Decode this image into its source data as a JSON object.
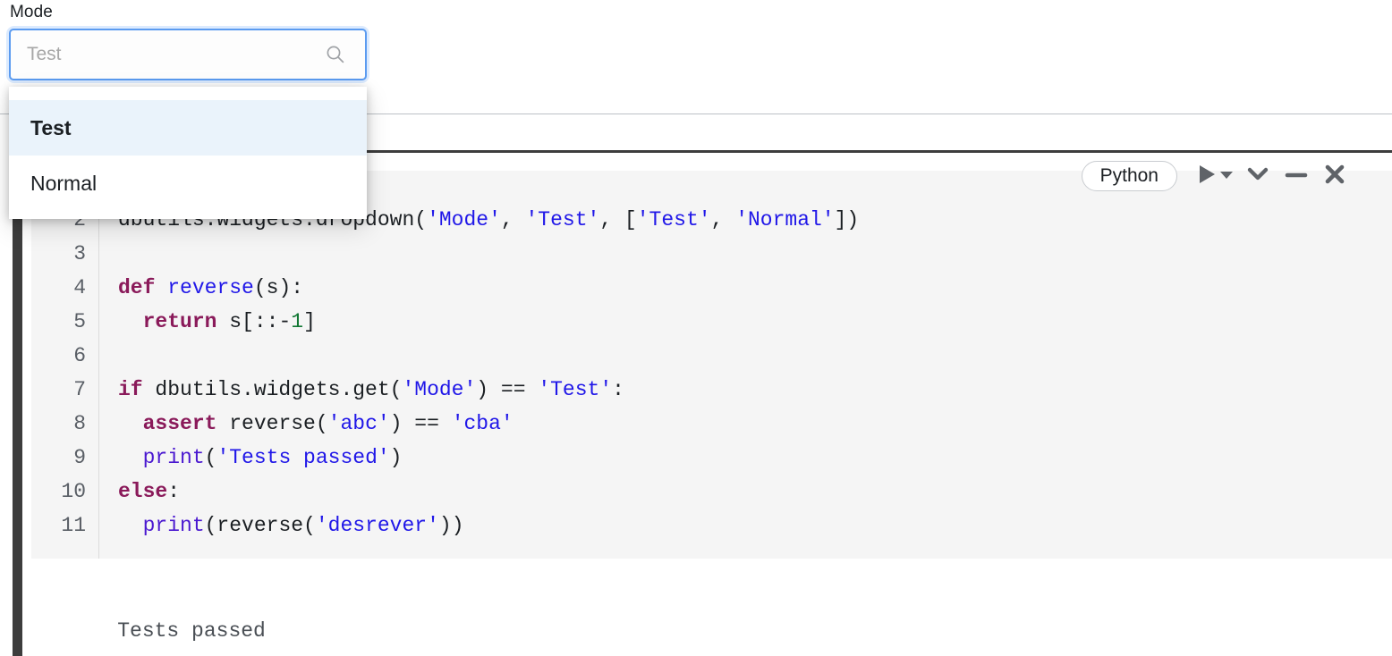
{
  "widget": {
    "label": "Mode",
    "input_value": "",
    "input_placeholder": "Test",
    "search_icon": "search-icon",
    "options": [
      {
        "label": "Test",
        "selected": true
      },
      {
        "label": "Normal",
        "selected": false
      }
    ],
    "focus_ring_color": "#5b9bf0",
    "selected_row_color": "#eaf3fb"
  },
  "cell": {
    "language_pill": "Python",
    "toolbar": {
      "run_icon": "play-icon",
      "run_menu_icon": "caret-down-icon",
      "collapse_icon": "chevron-down-icon",
      "minimize_icon": "minus-icon",
      "close_icon": "close-icon"
    },
    "accent_color": "#3d3d3d",
    "editor_background": "#f5f5f5",
    "line_numbers": [
      "2",
      "3",
      "4",
      "5",
      "6",
      "7",
      "8",
      "9",
      "10",
      "11"
    ],
    "code_lines": [
      {
        "n": "2",
        "tokens": [
          {
            "t": "plain",
            "v": "dbutils.widgets.dropdown("
          },
          {
            "t": "string",
            "v": "'Mode'"
          },
          {
            "t": "plain",
            "v": ", "
          },
          {
            "t": "string",
            "v": "'Test'"
          },
          {
            "t": "plain",
            "v": ", ["
          },
          {
            "t": "string",
            "v": "'Test'"
          },
          {
            "t": "plain",
            "v": ", "
          },
          {
            "t": "string",
            "v": "'Normal'"
          },
          {
            "t": "plain",
            "v": "])"
          }
        ]
      },
      {
        "n": "3",
        "tokens": []
      },
      {
        "n": "4",
        "tokens": [
          {
            "t": "keyword",
            "v": "def"
          },
          {
            "t": "plain",
            "v": " "
          },
          {
            "t": "function",
            "v": "reverse"
          },
          {
            "t": "plain",
            "v": "(s):"
          }
        ]
      },
      {
        "n": "5",
        "tokens": [
          {
            "t": "plain",
            "v": "  "
          },
          {
            "t": "keyword",
            "v": "return"
          },
          {
            "t": "plain",
            "v": " s[::-"
          },
          {
            "t": "number",
            "v": "1"
          },
          {
            "t": "plain",
            "v": "]"
          }
        ]
      },
      {
        "n": "6",
        "tokens": []
      },
      {
        "n": "7",
        "tokens": [
          {
            "t": "keyword",
            "v": "if"
          },
          {
            "t": "plain",
            "v": " dbutils.widgets.get("
          },
          {
            "t": "string",
            "v": "'Mode'"
          },
          {
            "t": "plain",
            "v": ") == "
          },
          {
            "t": "string",
            "v": "'Test'"
          },
          {
            "t": "plain",
            "v": ":"
          }
        ]
      },
      {
        "n": "8",
        "tokens": [
          {
            "t": "plain",
            "v": "  "
          },
          {
            "t": "keyword",
            "v": "assert"
          },
          {
            "t": "plain",
            "v": " reverse("
          },
          {
            "t": "string",
            "v": "'abc'"
          },
          {
            "t": "plain",
            "v": ") == "
          },
          {
            "t": "string",
            "v": "'cba'"
          }
        ]
      },
      {
        "n": "9",
        "tokens": [
          {
            "t": "plain",
            "v": "  "
          },
          {
            "t": "builtin",
            "v": "print"
          },
          {
            "t": "plain",
            "v": "("
          },
          {
            "t": "string",
            "v": "'Tests passed'"
          },
          {
            "t": "plain",
            "v": ")"
          }
        ]
      },
      {
        "n": "10",
        "tokens": [
          {
            "t": "keyword",
            "v": "else"
          },
          {
            "t": "plain",
            "v": ":"
          }
        ]
      },
      {
        "n": "11",
        "tokens": [
          {
            "t": "plain",
            "v": "  "
          },
          {
            "t": "builtin",
            "v": "print"
          },
          {
            "t": "plain",
            "v": "(reverse("
          },
          {
            "t": "string",
            "v": "'desrever'"
          },
          {
            "t": "plain",
            "v": "))"
          }
        ]
      }
    ],
    "output_text": "Tests passed"
  }
}
